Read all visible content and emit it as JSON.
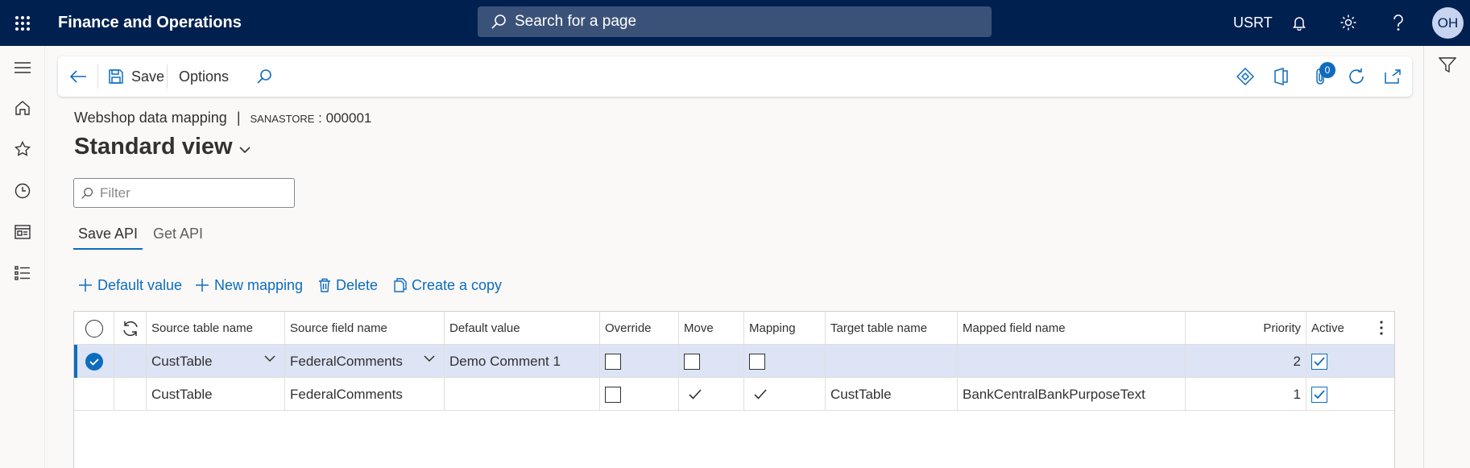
{
  "topbar": {
    "app_title": "Finance and Operations",
    "search_placeholder": "Search for a page",
    "company": "USRT",
    "avatar_initials": "OH"
  },
  "actionpane": {
    "save_label": "Save",
    "options_label": "Options",
    "attachments_count": "0"
  },
  "header": {
    "breadcrumb_title": "Webshop data mapping",
    "breadcrumb_separator": "|",
    "record_label": "SANASTORE",
    "record_value": " : 000001",
    "view_name": "Standard view",
    "filter_placeholder": "Filter"
  },
  "tabs": [
    {
      "label": "Save API",
      "active": true
    },
    {
      "label": "Get API",
      "active": false
    }
  ],
  "commands": {
    "default_value": "Default value",
    "new_mapping": "New mapping",
    "delete": "Delete",
    "create_copy": "Create a copy"
  },
  "grid": {
    "columns": [
      "Source table name",
      "Source field name",
      "Default value",
      "Override",
      "Move",
      "Mapping",
      "Target table name",
      "Mapped field name",
      "Priority",
      "Active"
    ],
    "rows": [
      {
        "source_table": "CustTable",
        "source_field": "FederalComments",
        "default_value": "Demo Comment 1",
        "override": false,
        "move": false,
        "mapping": false,
        "target_table": "",
        "mapped_field": "",
        "priority": "2",
        "active": true,
        "selected": true
      },
      {
        "source_table": "CustTable",
        "source_field": "FederalComments",
        "default_value": "",
        "override": false,
        "move": true,
        "mapping": true,
        "target_table": "CustTable",
        "mapped_field": "BankCentralBankPurposeText",
        "priority": "1",
        "active": true,
        "selected": false
      }
    ]
  },
  "colors": {
    "topbar": "#002050",
    "accent": "#0f6cbd",
    "selected_row": "#dce4f5"
  }
}
